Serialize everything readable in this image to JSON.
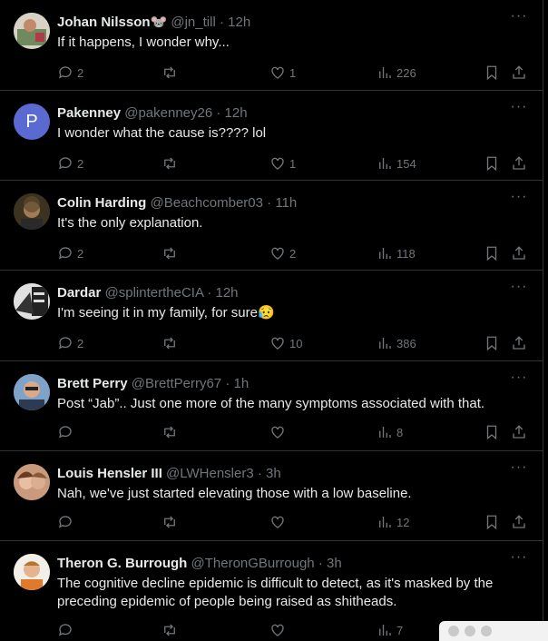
{
  "tweets": [
    {
      "name": "Johan Nilsson🐭",
      "handle": "@jn_till",
      "time": "12h",
      "text": "If it happens, I wonder why...",
      "replies": "2",
      "retweets": "",
      "likes": "1",
      "views": "226",
      "avatar_color": "#7a8b6a"
    },
    {
      "name": "Pakenney",
      "handle": "@pakenney26",
      "time": "12h",
      "text": "I wonder what the cause is???? lol",
      "replies": "2",
      "retweets": "",
      "likes": "1",
      "views": "154",
      "avatar_color": "#5b6ad0",
      "avatar_letter": "P"
    },
    {
      "name": "Colin Harding",
      "handle": "@Beachcomber03",
      "time": "11h",
      "text": "It's the only explanation.",
      "replies": "2",
      "retweets": "",
      "likes": "2",
      "views": "118",
      "avatar_color": "#5a4a2a"
    },
    {
      "name": "Dardar",
      "handle": "@splintertheCIA",
      "time": "12h",
      "text": "I'm seeing it in my family, for sure😥",
      "replies": "2",
      "retweets": "",
      "likes": "10",
      "views": "386",
      "avatar_color": "#8c8c8c"
    },
    {
      "name": "Brett Perry",
      "handle": "@BrettPerry67",
      "time": "1h",
      "text": "Post “Jab”.. Just one more of the many symptoms associated with that.",
      "replies": "",
      "retweets": "",
      "likes": "",
      "views": "8",
      "avatar_color": "#6d8fb3"
    },
    {
      "name": "Louis Hensler III",
      "handle": "@LWHensler3",
      "time": "3h",
      "text": "Nah, we've just started elevating those with a low baseline.",
      "replies": "",
      "retweets": "",
      "likes": "",
      "views": "12",
      "avatar_color": "#b07a5a"
    },
    {
      "name": "Theron G. Burrough",
      "handle": "@TheronGBurrough",
      "time": "3h",
      "text": "The cognitive decline epidemic is difficult to detect, as it's masked by the preceding epidemic of people being raised as shitheads.",
      "replies": "",
      "retweets": "",
      "likes": "",
      "views": "7",
      "avatar_color": "#d9b28a"
    }
  ],
  "dot_separator": "·",
  "more_label": "···"
}
